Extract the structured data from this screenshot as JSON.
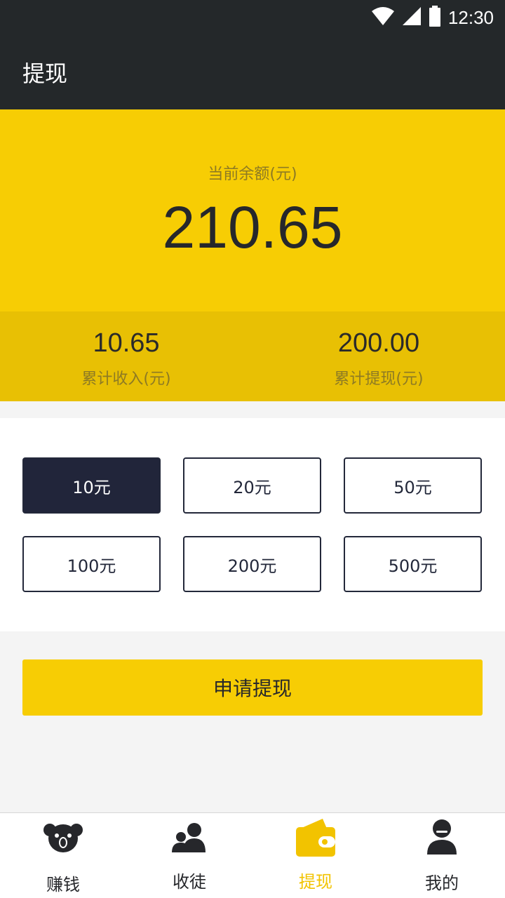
{
  "status_bar": {
    "time": "12:30"
  },
  "app_bar": {
    "title": "提现"
  },
  "balance": {
    "label": "当前余额(元)",
    "amount": "210.65"
  },
  "stats": {
    "income_value": "10.65",
    "income_label": "累计收入(元)",
    "withdrawn_value": "200.00",
    "withdrawn_label": "累计提现(元)"
  },
  "amount_options": [
    {
      "label": "10元",
      "selected": true
    },
    {
      "label": "20元",
      "selected": false
    },
    {
      "label": "50元",
      "selected": false
    },
    {
      "label": "100元",
      "selected": false
    },
    {
      "label": "200元",
      "selected": false
    },
    {
      "label": "500元",
      "selected": false
    }
  ],
  "submit_label": "申请提现",
  "tabs": [
    {
      "label": "赚钱",
      "icon": "koala-icon",
      "active": false
    },
    {
      "label": "收徒",
      "icon": "users-icon",
      "active": false
    },
    {
      "label": "提现",
      "icon": "wallet-icon",
      "active": true
    },
    {
      "label": "我的",
      "icon": "user-icon",
      "active": false
    }
  ],
  "colors": {
    "accent": "#f7cd04",
    "dark_header": "#24282a",
    "selected_option": "#21253a",
    "active_tab": "#f2c300"
  }
}
